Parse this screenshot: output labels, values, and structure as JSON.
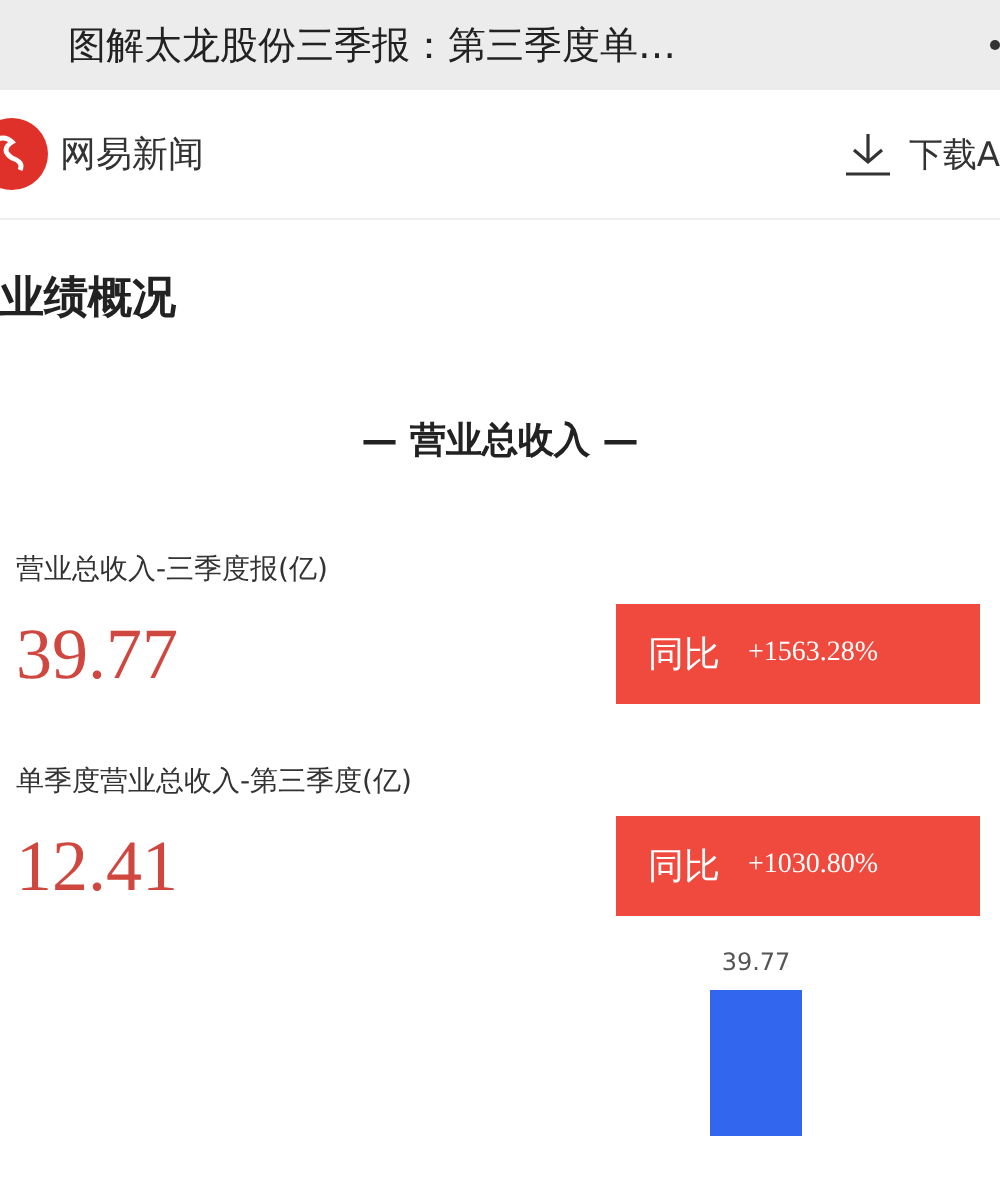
{
  "top_bar": {
    "title": "图解太龙股份三季报：第三季度单…"
  },
  "header": {
    "app_name": "网易新闻",
    "download": "下载A"
  },
  "section_title": "业绩概况",
  "subsection_title": "— 营业总收入 —",
  "metrics": [
    {
      "label": "营业总收入-三季度报(亿)",
      "value": "39.77",
      "badge_label": "同比",
      "change": "+1563.28%"
    },
    {
      "label": "单季度营业总收入-第三季度(亿)",
      "value": "12.41",
      "badge_label": "同比",
      "change": "+1030.80%"
    }
  ],
  "bar_chart": {
    "bars": [
      {
        "value_label": "39.77"
      }
    ]
  }
}
